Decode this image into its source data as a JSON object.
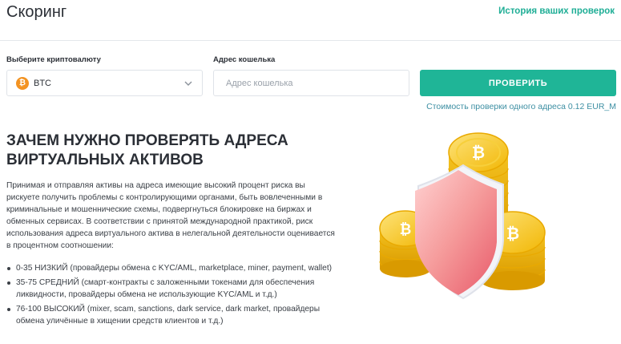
{
  "header": {
    "title": "Скоринг",
    "history_link": "История ваших проверок"
  },
  "form": {
    "crypto_label": "Выберите криптовалюту",
    "crypto_value": "BTC",
    "crypto_icon": "bitcoin-icon",
    "wallet_label": "Адрес кошелька",
    "wallet_placeholder": "Адрес кошелька",
    "wallet_value": "",
    "check_button": "ПРОВЕРИТЬ",
    "price_note": "Стоимость проверки одного адреса 0.12 EUR_M"
  },
  "info": {
    "heading": "ЗАЧЕМ НУЖНО ПРОВЕРЯТЬ АДРЕСА ВИРТУАЛЬНЫХ АКТИВОВ",
    "paragraph": "Принимая и отправляя активы на адреса имеющие высокий процент риска вы рискуете получить проблемы с контролирующими органами, быть вовлеченными в криминальные и мошеннические схемы, подвергнуться блокировке на биржах и обменных сервисах. В соответствии с принятой международной практикой, риск использования адреса виртуального актива в нелегальной деятельности оценивается в процентном соотношении:",
    "risk_levels": [
      "0-35 НИЗКИЙ (провайдеры обмена с KYC/AML, marketplace, miner, payment, wallet)",
      "35-75 СРЕДНИЙ (смарт-контракты с заложенными токенами для обеспечения ликвидности, провайдеры обмена не использующие KYC/AML и т.д.)",
      "76-100 ВЫСОКИЙ (mixer, scam, sanctions, dark service, dark market, провайдеры обмена уличённые в хищении средств клиентов и т.д.)"
    ]
  },
  "colors": {
    "accent": "#1fb597",
    "link": "#1fae96",
    "note": "#3d8fa3",
    "coin": "#f4c21f",
    "shield": "#f07a7a"
  }
}
